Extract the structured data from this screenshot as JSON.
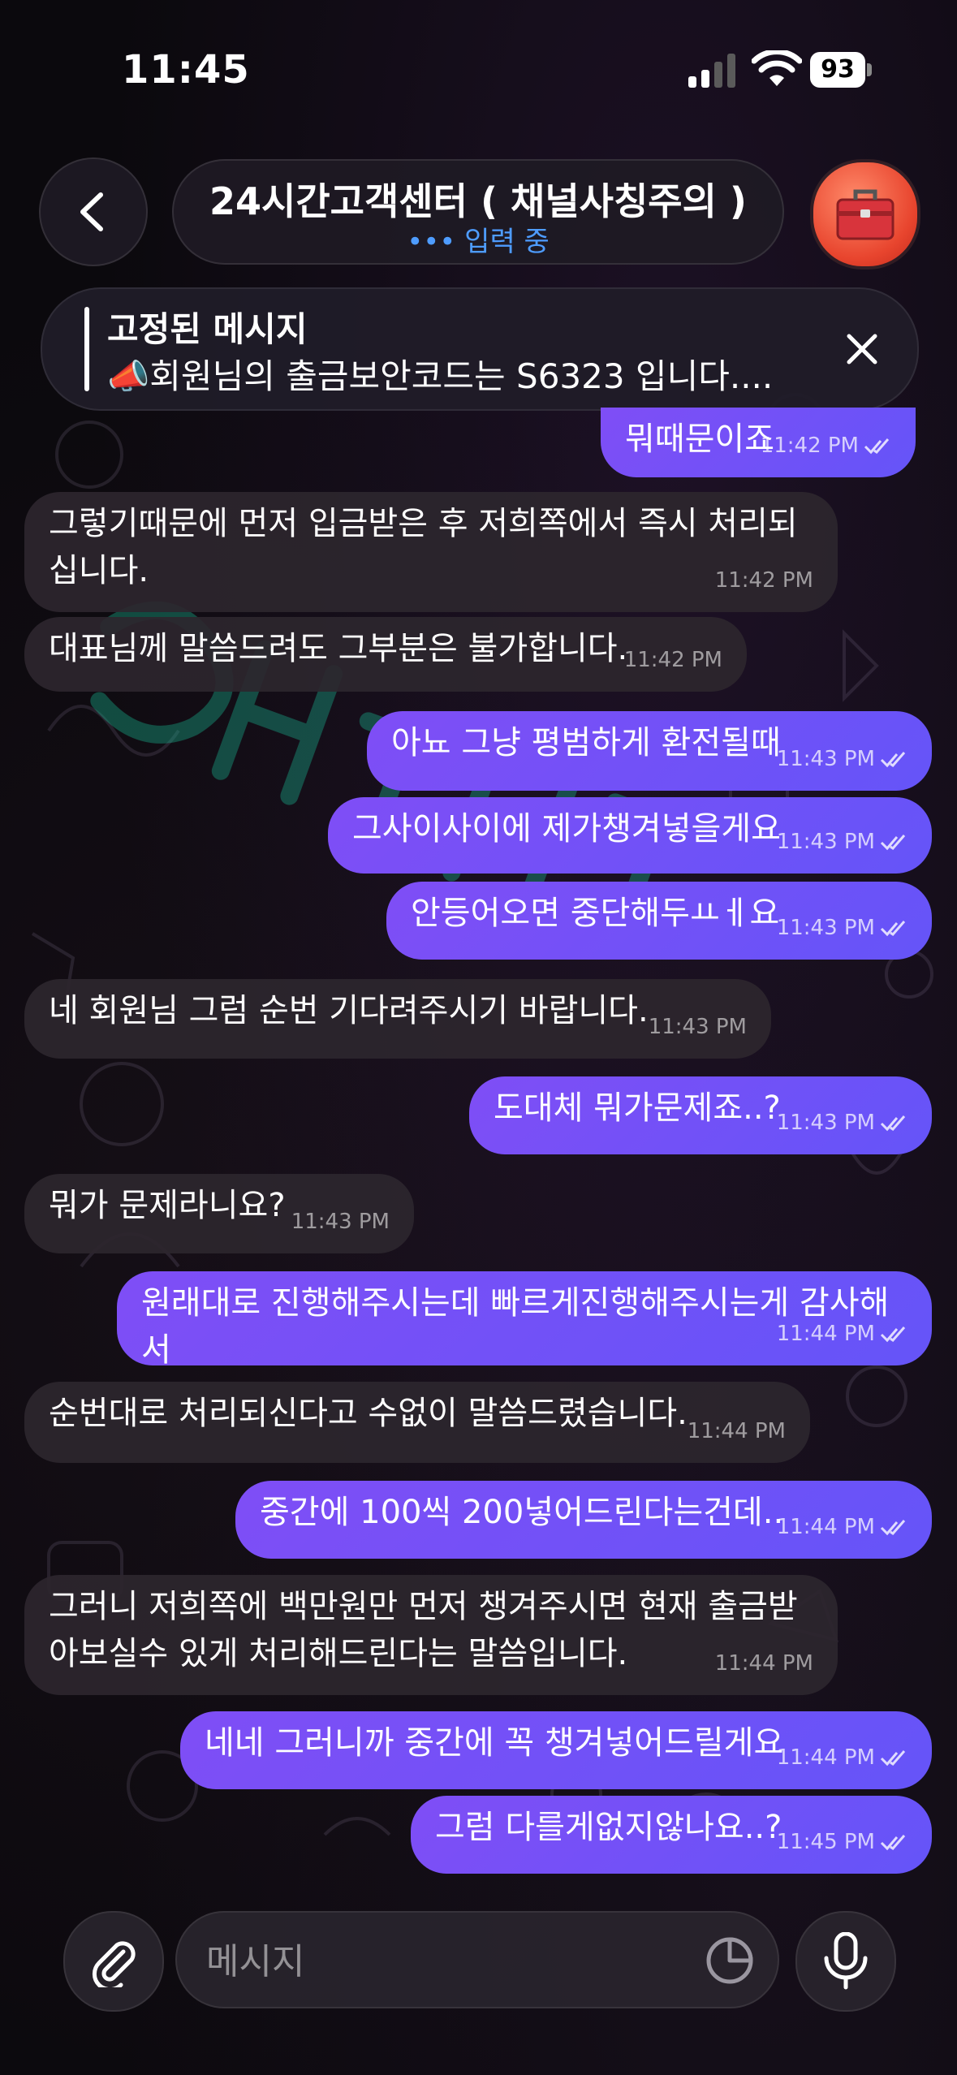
{
  "status_bar": {
    "time": "11:45",
    "battery": "93"
  },
  "header": {
    "title": "24시간고객센터 ( 채널사칭주의 )",
    "status": "••• 입력 중"
  },
  "pinned": {
    "title": "고정된 메시지",
    "text": "📣회원님의 출금보안코드는 S6323 입니다...."
  },
  "messages": [
    {
      "dir": "out",
      "text": "뭐때문이죠",
      "time": "11:42 PM",
      "read": true
    },
    {
      "dir": "in",
      "text": "그렇기때문에 먼저 입금받은 후 저희쪽에서 즉시 처리되십니다.",
      "time": "11:42 PM"
    },
    {
      "dir": "in",
      "text": "대표님께 말씀드려도 그부분은 불가합니다.",
      "time": "11:42 PM"
    },
    {
      "dir": "out",
      "text": "아뇨 그냥 평범하게 환전될때",
      "time": "11:43 PM",
      "read": true
    },
    {
      "dir": "out",
      "text": "그사이사이에 제가챙겨넣을게요",
      "time": "11:43 PM",
      "read": true
    },
    {
      "dir": "out",
      "text": "안등어오면 중단해두ㅛㅔ요",
      "time": "11:43 PM",
      "read": true
    },
    {
      "dir": "in",
      "text": "네 회원님 그럼 순번 기다려주시기 바랍니다.",
      "time": "11:43 PM"
    },
    {
      "dir": "out",
      "text": "도대체 뭐가문제죠..?",
      "time": "11:43 PM",
      "read": true
    },
    {
      "dir": "in",
      "text": "뭐가 문제라니요?",
      "time": "11:43 PM"
    },
    {
      "dir": "out",
      "text": "원래대로 진행해주시는데 빠르게진행해주시는게 감사해서",
      "time": "11:44 PM",
      "read": true
    },
    {
      "dir": "in",
      "text": "순번대로 처리되신다고 수없이 말씀드렸습니다.",
      "time": "11:44 PM"
    },
    {
      "dir": "out",
      "text": "중간에 100씩 200넣어드린다는건데..",
      "time": "11:44 PM",
      "read": true
    },
    {
      "dir": "in",
      "text": "그러니 저희쪽에 백만원만 먼저 챙겨주시면 현재 출금받아보실수 있게 처리해드린다는 말씀입니다.",
      "time": "11:44 PM"
    },
    {
      "dir": "out",
      "text": "네네 그러니까 중간에 꼭 챙겨넣어드릴게요",
      "time": "11:44 PM",
      "read": true
    },
    {
      "dir": "out",
      "text": "그럼 다를게없지않나요..?",
      "time": "11:45 PM",
      "read": true
    }
  ],
  "input": {
    "placeholder": "메시지"
  },
  "icons": {
    "back": "chevron-left-icon",
    "close": "close-icon",
    "attach": "paperclip-icon",
    "sticker": "sticker-icon",
    "mic": "microphone-icon",
    "avatar": "toolbox-icon"
  },
  "colors": {
    "outgoing_bubble": "#7f4ef6",
    "incoming_bubble": "#2c262e",
    "typing_status": "#4e9cff",
    "avatar": "#e8452e"
  }
}
